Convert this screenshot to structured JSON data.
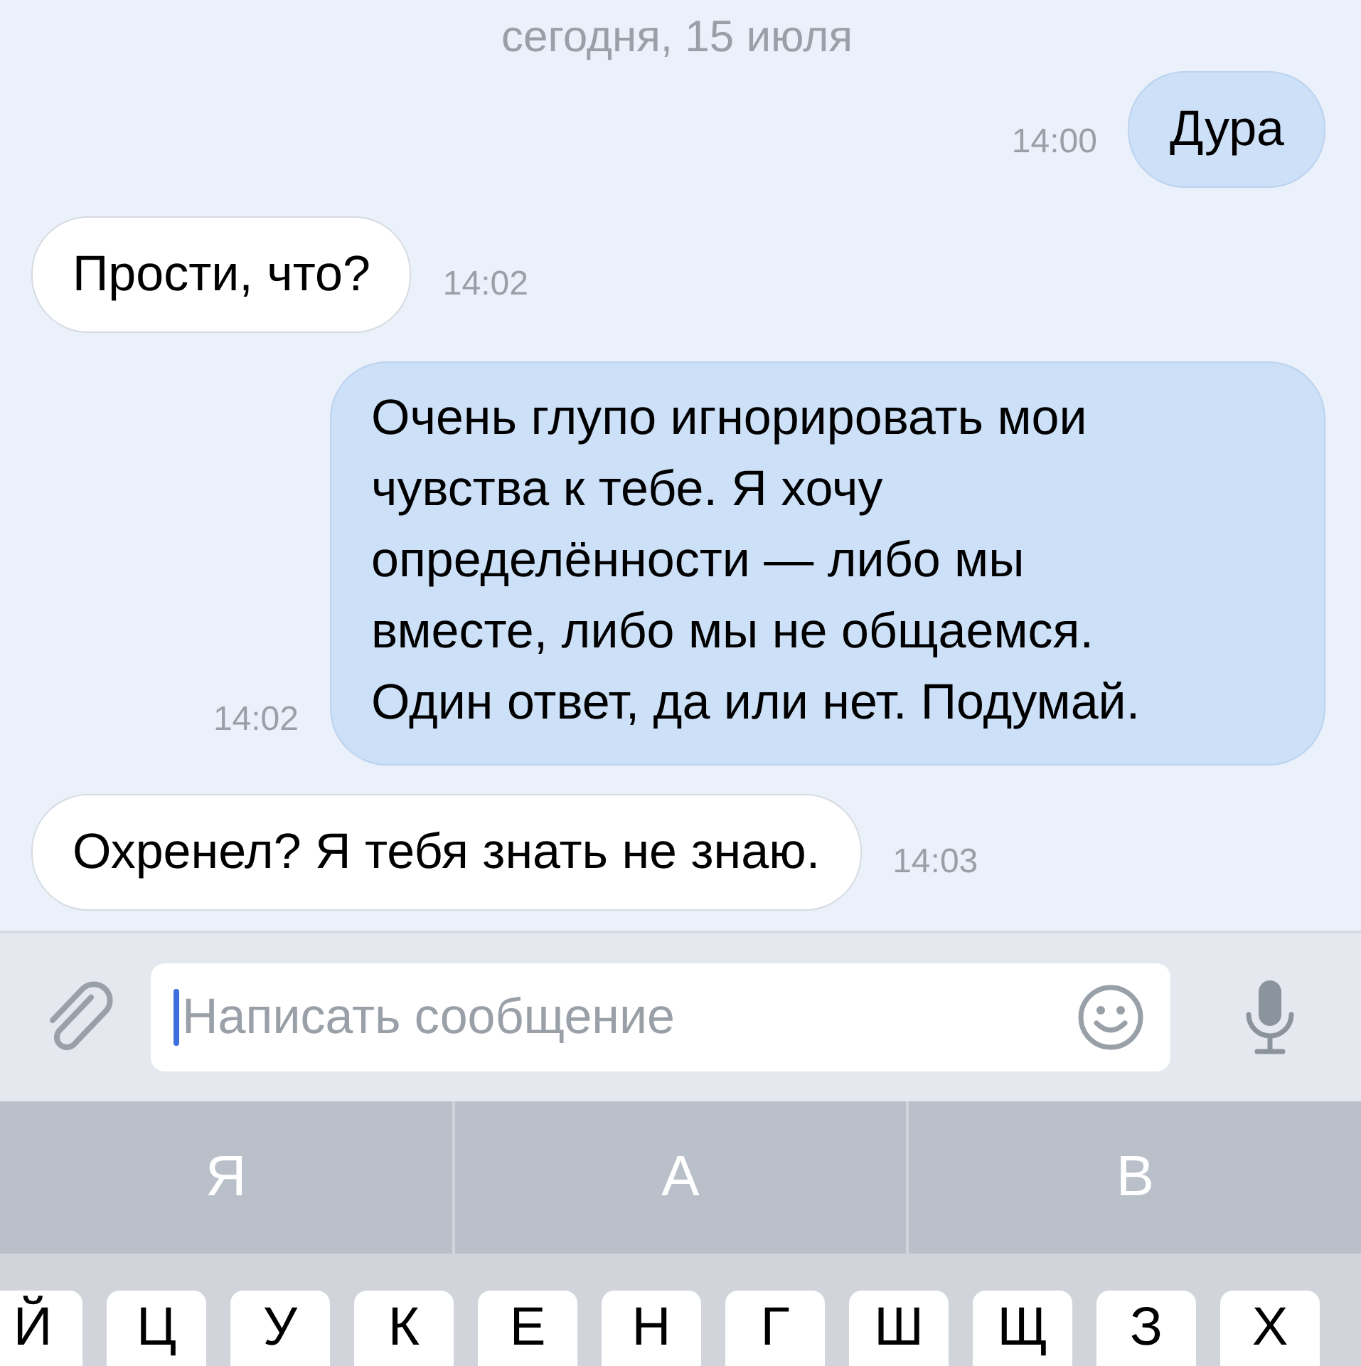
{
  "date_header": "сегодня, 15 июля",
  "messages": [
    {
      "text": "Дура",
      "time": "14:00",
      "outgoing": true
    },
    {
      "text": "Прости, что?",
      "time": "14:02",
      "outgoing": false
    },
    {
      "text": "Очень глупо игнорировать мои чувства к тебе. Я хочу определённости — либо мы вместе, либо мы не общаемся. Один ответ, да или нет. Подумай.",
      "time": "14:02",
      "outgoing": true
    },
    {
      "text": "Охренел? Я тебя знать не знаю.",
      "time": "14:03",
      "outgoing": false
    }
  ],
  "composer": {
    "placeholder": "Написать сообщение"
  },
  "suggestions": [
    "Я",
    "А",
    "В"
  ],
  "keys": [
    "Й",
    "Ц",
    "У",
    "К",
    "Е",
    "Н",
    "Г",
    "Ш",
    "Щ",
    "З",
    "Х"
  ]
}
